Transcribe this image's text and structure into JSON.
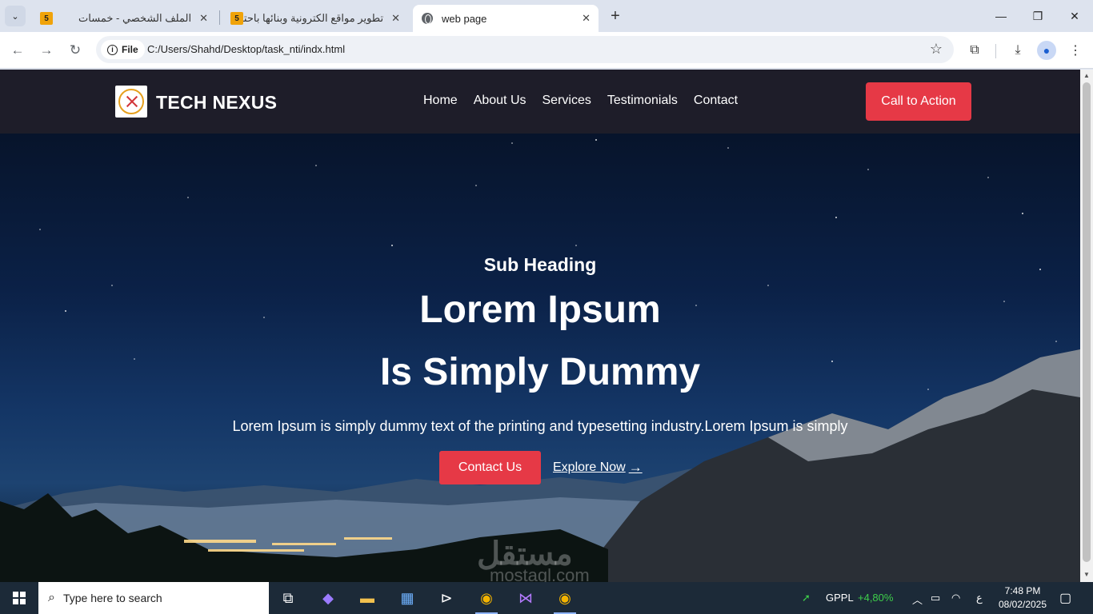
{
  "browser": {
    "tabs": [
      {
        "title": "الملف الشخصي - خمسات",
        "favicon": "5"
      },
      {
        "title": "تطوير مواقع الكترونية وبنائها باحتر",
        "favicon": "5"
      },
      {
        "title": "web page"
      }
    ],
    "site_chip": "File",
    "url": "C:/Users/Shahd/Desktop/task_nti/indx.html"
  },
  "site": {
    "brand": "TECH NEXUS",
    "nav": [
      "Home",
      "About Us",
      "Services",
      "Testimonials",
      "Contact"
    ],
    "cta": "Call to Action",
    "colors": {
      "accent": "#e63946",
      "nav_bg": "#1e1d29"
    }
  },
  "hero": {
    "sub_heading": "Sub Heading",
    "title_line1": "Lorem Ipsum",
    "title_line2": "Is Simply Dummy",
    "paragraph": "Lorem Ipsum is simply dummy text of the printing and typesetting industry.Lorem Ipsum is simply",
    "contact_button": "Contact Us",
    "explore_link": "Explore Now",
    "watermark": "مستقل",
    "watermark_sub": "mostaql.com"
  },
  "taskbar": {
    "search_placeholder": "Type here to search",
    "stock_name": "GPPL",
    "stock_change": "+4,80%",
    "lang": "ع",
    "time": "7:48 PM",
    "date": "08/02/2025"
  }
}
